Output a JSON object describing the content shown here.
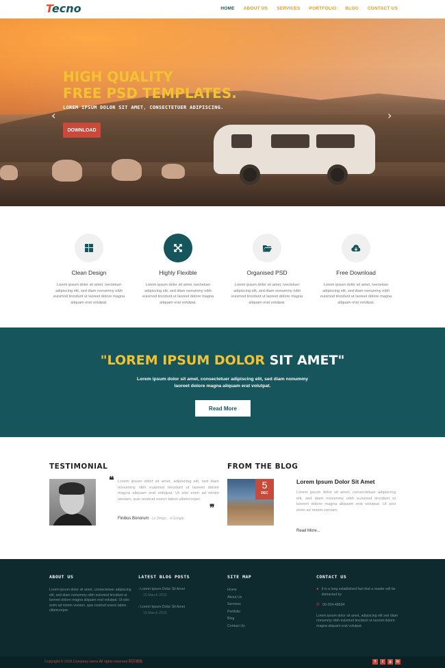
{
  "nav": {
    "logo_first": "T",
    "logo_rest": "ecno",
    "items": [
      "HOME",
      "ABOUT US",
      "SERVICES",
      "PORTFOLIO",
      "BLOG",
      "CONTACT US"
    ]
  },
  "hero": {
    "title_line1": "HIGH QUALITY",
    "title_line2": "FREE PSD TEMPLATES.",
    "subtitle": "LOREM IPSUM DOLOR SIT AMET, CONSECTETUER ADIPISCING.",
    "button": "DOWNLOAD",
    "prev": "‹",
    "next": "›"
  },
  "features": [
    {
      "title": "Clean Design",
      "text": "Lorem ipsum dolor sit amet, ivectetuer adipiscing elit, sed diam nonummy nibh euismod tincidunt ut laoreet dolore magna aliquam erat volutpat."
    },
    {
      "title": "Highly Flexible",
      "text": "Lorem ipsum dolor sit amet, ivectetuer adipiscing elit, sed diam nonummy nibh euismod tincidunt ut laoreet dolore magna aliquam erat volutpat."
    },
    {
      "title": "Organised PSD",
      "text": "Lorem ipsum dolor sit amet, ivectetuer adipiscing elit, sed diam nonummy nibh euismod tincidunt ut laoreet dolore magna aliquam erat volutpat."
    },
    {
      "title": "Free Download",
      "text": "Lorem ipsum dolor sit amet, ivectetuer adipiscing elit, sed diam nonummy nibh euismod tincidunt ut laoreet dolore magna aliquam erat volutpat."
    }
  ],
  "banner": {
    "heading_yellow": "\"LOREM IPSUM DOLOR ",
    "heading_white": "SIT AMET\"",
    "text": "Lorem ipsum dolor sit amet, consectetuer adipiscing elit, sed diam nonummy laoreet dolore magna aliquam erat volutpat.",
    "button": "Read More"
  },
  "testimonial": {
    "heading": "TESTIMONIAL",
    "text": "Lorem ipsum dolor sit amet, adipiscing elit, sed diam nonummy nibh euismod tincidunt ut laoreet dolore magna aliquam erat volutpat. Ut wisi enim ad minim veniam, quis nostrud exerci tation ullamcorper.",
    "author": "Finibus Bonorum",
    "source": "- Le Zimgs... d Google"
  },
  "blog": {
    "heading": "FROM THE BLOG",
    "day": "5",
    "month": "DEC",
    "title": "Lorem Ipsum Dolor Sit Amet",
    "text": "Lorem ipsum dolor sit amet, consectetuer adipiscing elit, sed diam nonummy nibh euismod tincidunt ut laoreet dolore magna aliquam erat volutpat. Ut wisi enim ad minim veniam.",
    "more": "Read More..."
  },
  "footer": {
    "about_title": "ABOUT US",
    "about_text": "Lorem ipsum dolor sit amet, consectetuer adipiscing elit, sed diam nonummy nibh euismod tincidunt ut laoreet dolore magna aliquam erat volutpat. Ut wisi enim ad minim veniam, quis nostrud exerci tation ullamcorper.",
    "posts_title": "LATEST BLOG POSTS",
    "posts": [
      {
        "title": "Lorem Ipsum Dolor Sit Amet",
        "date": "15 March 2015"
      },
      {
        "title": "Lorem Ipsum Dolor Sit Amet",
        "date": "15 March 2015"
      }
    ],
    "sitemap_title": "SITE MAP",
    "sitemap": [
      "Home",
      "About Us",
      "Services",
      "Portfolio",
      "Blog",
      "Contact Us"
    ],
    "contact_title": "CONTACT US",
    "contact_address": "It is a long established fact that a reader will be distracted by",
    "contact_phone": "00-254-48694",
    "contact_text": "Lorem ipsum dolor sit amet, adipiscing elit sed diam nonummy nibh euismod tincidunt ut laoreet dolore magna aliquam erat volutpat.",
    "copyright": "Copyright © 2015.Company name All rights reserved.网页模板",
    "social": [
      "f",
      "t",
      "g",
      "in"
    ]
  },
  "colors": {
    "teal": "#16555c",
    "orange": "#e59a1c",
    "red": "#c84a3a",
    "yellow": "#f2c232",
    "footer": "#0e2a2e"
  }
}
